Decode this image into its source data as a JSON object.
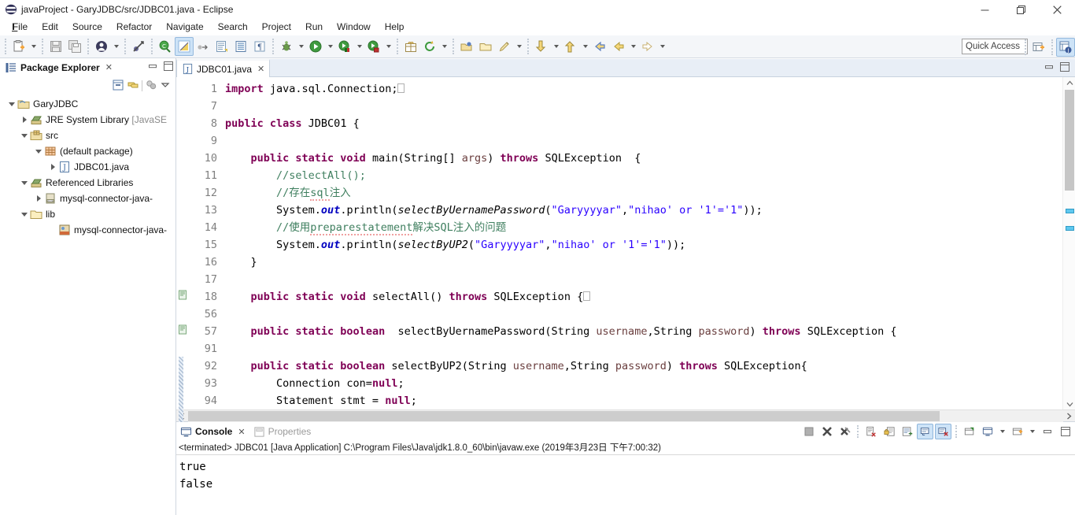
{
  "window": {
    "title": "javaProject - GaryJDBC/src/JDBC01.java - Eclipse",
    "app_icon": "eclipse-icon",
    "minimize_label": "Minimize",
    "maximize_label": "Restore",
    "close_label": "Close"
  },
  "menubar": {
    "items": [
      {
        "label": "File",
        "mnemonic": "F"
      },
      {
        "label": "Edit",
        "mnemonic": "E"
      },
      {
        "label": "Source",
        "mnemonic": "S"
      },
      {
        "label": "Refactor",
        "mnemonic": "t"
      },
      {
        "label": "Navigate",
        "mnemonic": "N"
      },
      {
        "label": "Search",
        "mnemonic": "a"
      },
      {
        "label": "Project",
        "mnemonic": "P"
      },
      {
        "label": "Run",
        "mnemonic": "R"
      },
      {
        "label": "Window",
        "mnemonic": "W"
      },
      {
        "label": "Help",
        "mnemonic": "H"
      }
    ]
  },
  "toolbar": {
    "quick_access_placeholder": "Quick Access",
    "buttons": [
      {
        "name": "new-wizard-button",
        "icon": "new-file-icon"
      },
      {
        "name": "new-dropdown",
        "icon": "chevron-down-icon"
      },
      {
        "name": "save-button",
        "icon": "save-icon"
      },
      {
        "name": "save-all-button",
        "icon": "save-all-icon"
      },
      {
        "name": "new-java-package-button",
        "icon": "user-icon"
      },
      {
        "name": "new-java-dropdown",
        "icon": "chevron-down-icon"
      },
      {
        "name": "toggle-breakpoint-button",
        "icon": "breakpoint-skip-icon"
      },
      {
        "name": "open-type-button",
        "icon": "open-type-icon"
      },
      {
        "name": "external-tools-button",
        "icon": "external-tools-icon"
      },
      {
        "name": "next-annotation-button",
        "icon": "next-annotation-icon"
      },
      {
        "name": "new-java-class-button",
        "icon": "new-class-icon"
      },
      {
        "name": "new-interface-button",
        "icon": "new-interface-icon"
      },
      {
        "name": "debug-button",
        "icon": "debug-bug-icon"
      },
      {
        "name": "debug-dropdown",
        "icon": "chevron-down-icon"
      },
      {
        "name": "run-button",
        "icon": "run-play-icon"
      },
      {
        "name": "run-dropdown",
        "icon": "chevron-down-icon"
      },
      {
        "name": "coverage-button",
        "icon": "coverage-icon"
      },
      {
        "name": "coverage-dropdown",
        "icon": "chevron-down-icon"
      },
      {
        "name": "run-last-tool-button",
        "icon": "run-tool-icon"
      },
      {
        "name": "run-last-dropdown",
        "icon": "chevron-down-icon"
      },
      {
        "name": "new-package-button",
        "icon": "package-gift-icon"
      },
      {
        "name": "refresh-button",
        "icon": "refresh-icon"
      },
      {
        "name": "refresh-dropdown",
        "icon": "chevron-down-icon"
      },
      {
        "name": "open-task-button",
        "icon": "open-folder-icon"
      },
      {
        "name": "open-folder-button",
        "icon": "folder-icon"
      },
      {
        "name": "edit-button",
        "icon": "pencil-icon"
      },
      {
        "name": "edit-dropdown",
        "icon": "chevron-down-icon"
      },
      {
        "name": "next-member-button",
        "icon": "down-arrow-icon"
      },
      {
        "name": "next-member-dropdown",
        "icon": "chevron-down-icon"
      },
      {
        "name": "previous-member-button",
        "icon": "up-arrow-icon"
      },
      {
        "name": "previous-member-dropdown",
        "icon": "chevron-down-icon"
      },
      {
        "name": "back-button",
        "icon": "back-arrow-icon"
      },
      {
        "name": "forward-yellow-button",
        "icon": "left-arrow-icon"
      },
      {
        "name": "forward-dropdown",
        "icon": "chevron-down-icon"
      },
      {
        "name": "next-button",
        "icon": "right-arrow-icon"
      },
      {
        "name": "next-dropdown",
        "icon": "chevron-down-icon"
      }
    ],
    "perspective": [
      {
        "name": "open-perspective-button",
        "icon": "open-perspective-icon"
      },
      {
        "name": "java-perspective-button",
        "icon": "java-perspective-icon"
      }
    ]
  },
  "explorer": {
    "title": "Package Explorer",
    "close_glyph": "✕",
    "view_toolbar": [
      {
        "name": "collapse-all-button",
        "icon": "collapse-all-icon"
      },
      {
        "name": "link-with-editor-button",
        "icon": "link-editor-icon"
      },
      {
        "name": "focus-on-active-task-button",
        "icon": "focus-task-icon"
      },
      {
        "name": "view-menu-button",
        "icon": "chevron-down-icon"
      }
    ],
    "minimize_label": "Minimize",
    "maximize_label": "Maximize",
    "tree": [
      {
        "label": "GaryJDBC",
        "depth": 0,
        "twisty": "open",
        "icon": "java-project-icon",
        "dim": ""
      },
      {
        "label": "JRE System Library ",
        "depth": 1,
        "twisty": "closed",
        "icon": "library-icon",
        "dim": "[JavaSE"
      },
      {
        "label": "src",
        "depth": 1,
        "twisty": "open",
        "icon": "source-folder-icon",
        "dim": ""
      },
      {
        "label": "(default package)",
        "depth": 2,
        "twisty": "open",
        "icon": "package-icon",
        "dim": ""
      },
      {
        "label": "JDBC01.java",
        "depth": 3,
        "twisty": "closed",
        "icon": "java-file-icon",
        "dim": ""
      },
      {
        "label": "Referenced Libraries",
        "depth": 1,
        "twisty": "open",
        "icon": "library-icon",
        "dim": ""
      },
      {
        "label": "mysql-connector-java-",
        "depth": 2,
        "twisty": "closed",
        "icon": "jar-icon",
        "dim": ""
      },
      {
        "label": "lib",
        "depth": 1,
        "twisty": "open",
        "icon": "folder-icon",
        "dim": ""
      },
      {
        "label": "mysql-connector-java-",
        "depth": 2,
        "twisty": "none",
        "icon": "jar-file-icon",
        "dim": ""
      }
    ]
  },
  "editor": {
    "tab_label": "JDBC01.java",
    "tab_icon": "java-file-icon",
    "tab_close_glyph": "✕",
    "minimize_label": "Minimize",
    "maximize_label": "Maximize",
    "lines": [
      {
        "num": "1",
        "fold": "plus",
        "marker": "",
        "change": false
      },
      {
        "num": "7",
        "fold": "",
        "marker": "",
        "change": false
      },
      {
        "num": "8",
        "fold": "",
        "marker": "",
        "change": false
      },
      {
        "num": "9",
        "fold": "",
        "marker": "",
        "change": false
      },
      {
        "num": "10",
        "fold": "minus",
        "marker": "",
        "change": false
      },
      {
        "num": "11",
        "fold": "",
        "marker": "",
        "change": false
      },
      {
        "num": "12",
        "fold": "",
        "marker": "",
        "change": false
      },
      {
        "num": "13",
        "fold": "",
        "marker": "",
        "change": false
      },
      {
        "num": "14",
        "fold": "",
        "marker": "",
        "change": false
      },
      {
        "num": "15",
        "fold": "",
        "marker": "",
        "change": false
      },
      {
        "num": "16",
        "fold": "",
        "marker": "",
        "change": false
      },
      {
        "num": "17",
        "fold": "",
        "marker": "",
        "change": false
      },
      {
        "num": "18",
        "fold": "plus",
        "marker": "warning",
        "change": false
      },
      {
        "num": "56",
        "fold": "",
        "marker": "",
        "change": false
      },
      {
        "num": "57",
        "fold": "plus",
        "marker": "warning",
        "change": false
      },
      {
        "num": "91",
        "fold": "",
        "marker": "",
        "change": true
      },
      {
        "num": "92",
        "fold": "minus",
        "marker": "",
        "change": true
      },
      {
        "num": "93",
        "fold": "",
        "marker": "",
        "change": true
      },
      {
        "num": "94",
        "fold": "",
        "marker": "",
        "change": true
      }
    ],
    "code_text": [
      "import java.sql.Connection;",
      "",
      "public class JDBC01 {",
      "",
      "    public static void main(String[] args) throws SQLException  {",
      "        //selectAll();",
      "        //存在sql注入",
      "        System.out.println(selectByUernamePassword(\"Garyyyyar\",\"nihao' or '1'='1\"));",
      "        //使用preparestatement解决SQL注入的问题",
      "        System.out.println(selectByUP2(\"Garyyyyar\",\"nihao' or '1'='1\"));",
      "    }",
      "",
      "    public static void selectAll() throws SQLException {",
      "",
      "    public static boolean  selectByUernamePassword(String username,String password) throws SQLException {",
      "",
      "    public static boolean selectByUP2(String username,String password) throws SQLException{",
      "        Connection con=null;",
      "        Statement stmt = null;"
    ],
    "scroll_markers": 2
  },
  "console": {
    "tabs": [
      {
        "label": "Console",
        "icon": "console-icon",
        "active": true,
        "close_glyph": "✕"
      },
      {
        "label": "Properties",
        "icon": "properties-icon",
        "active": false,
        "close_glyph": ""
      }
    ],
    "header": "<terminated> JDBC01 [Java Application] C:\\Program Files\\Java\\jdk1.8.0_60\\bin\\javaw.exe (2019年3月23日 下午7:00:32)",
    "output": [
      "true",
      "false"
    ],
    "toolbar": [
      {
        "name": "terminate-button",
        "icon": "stop-square-icon",
        "on": false
      },
      {
        "name": "remove-launch-button",
        "icon": "remove-x-icon",
        "on": false
      },
      {
        "name": "remove-all-terminated-button",
        "icon": "remove-all-x-icon",
        "on": false
      },
      {
        "name": "clear-console-button",
        "icon": "clear-console-icon",
        "on": false
      },
      {
        "name": "scroll-lock-button",
        "icon": "scroll-lock-icon",
        "on": false
      },
      {
        "name": "word-wrap-button",
        "icon": "word-wrap-icon",
        "on": false
      },
      {
        "name": "show-console-on-output-button",
        "icon": "show-on-output-icon",
        "on": true
      },
      {
        "name": "show-console-on-error-button",
        "icon": "show-on-error-icon",
        "on": true
      },
      {
        "name": "pin-console-button",
        "icon": "pin-console-icon",
        "on": false
      },
      {
        "name": "display-selected-console-button",
        "icon": "display-console-icon",
        "on": false
      },
      {
        "name": "display-console-dropdown",
        "icon": "chevron-down-icon",
        "on": false
      },
      {
        "name": "open-console-button",
        "icon": "open-console-icon",
        "on": false
      },
      {
        "name": "open-console-dropdown",
        "icon": "chevron-down-icon",
        "on": false
      },
      {
        "name": "minimize-console-button",
        "icon": "minimize-icon",
        "on": false
      },
      {
        "name": "maximize-console-button",
        "icon": "maximize-icon",
        "on": false
      }
    ]
  },
  "colors": {
    "keyword": "#7f0055",
    "string": "#2a00ff",
    "comment": "#3f7f5f",
    "field": "#0000c0",
    "parameter": "#6a3e3e",
    "toolbar_bg": "#f4f6f9",
    "active_toggle": "#cde3f7"
  }
}
